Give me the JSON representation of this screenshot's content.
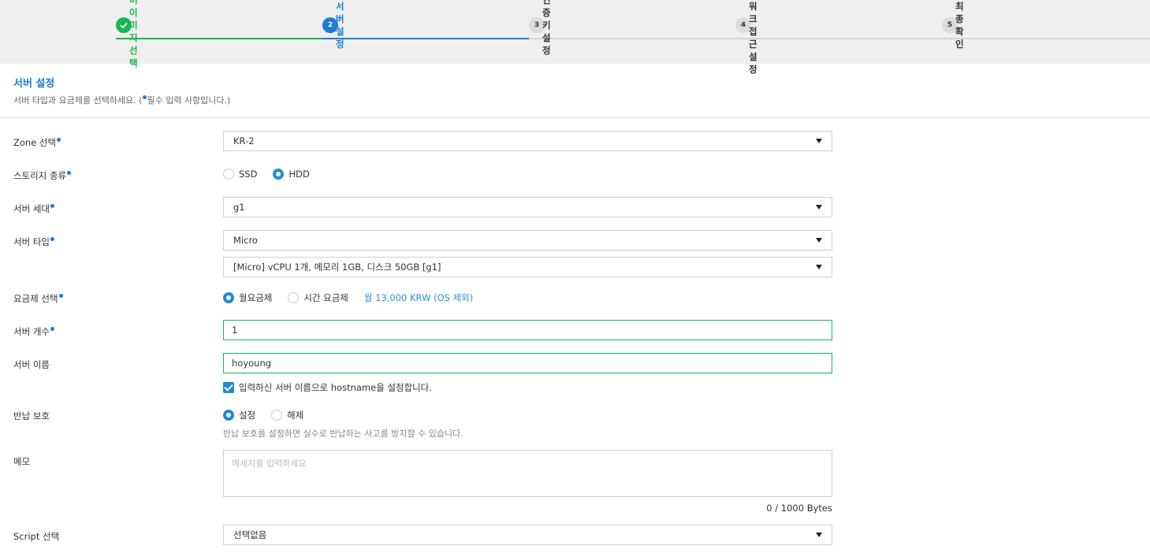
{
  "stepper": {
    "steps": [
      {
        "num": "",
        "label": "서버 이미지 선택",
        "state": "done"
      },
      {
        "num": "2",
        "label": "서버 설정",
        "state": "active"
      },
      {
        "num": "3",
        "label": "인증키 설정",
        "state": "pending"
      },
      {
        "num": "4",
        "label": "네트워크 접근 설정",
        "state": "pending"
      },
      {
        "num": "5",
        "label": "최종 확인",
        "state": "pending"
      }
    ]
  },
  "section": {
    "title": "서버 설정",
    "desc_pre": "서버 타입과 요금제를 선택하세요. (",
    "desc_post": "필수 입력 사항입니다.)"
  },
  "form": {
    "zone": {
      "label": "Zone 선택",
      "value": "KR-2"
    },
    "storage": {
      "label": "스토리지 종류",
      "options": [
        "SSD",
        "HDD"
      ],
      "selected": "HDD"
    },
    "generation": {
      "label": "서버 세대",
      "value": "g1"
    },
    "server_type": {
      "label": "서버 타입",
      "value": "Micro",
      "spec": "[Micro] vCPU 1개, 메모리 1GB, 디스크 50GB [g1]"
    },
    "plan": {
      "label": "요금제 선택",
      "options": [
        "월요금제",
        "시간 요금제"
      ],
      "selected": "월요금제",
      "price": "월 13,000 KRW (OS 제외)"
    },
    "count": {
      "label": "서버 개수",
      "value": "1"
    },
    "name": {
      "label": "서버 이름",
      "value": "hoyoung",
      "hostname_check": "입력하신 서버 이름으로 hostname을 설정합니다."
    },
    "protect": {
      "label": "반납 보호",
      "options": [
        "설정",
        "해제"
      ],
      "selected": "설정",
      "help": "반납 보호를 설정하면 실수로 반납하는 사고를 방지할 수 있습니다."
    },
    "memo": {
      "label": "메모",
      "placeholder": "메세지를 입력하세요",
      "counter": "0 / 1000 Bytes"
    },
    "script": {
      "label": "Script 선택",
      "value": "선택없음"
    }
  },
  "colors": {
    "accent": "#1f7bd3",
    "success": "#19b553",
    "price": "#2a8fd6"
  }
}
